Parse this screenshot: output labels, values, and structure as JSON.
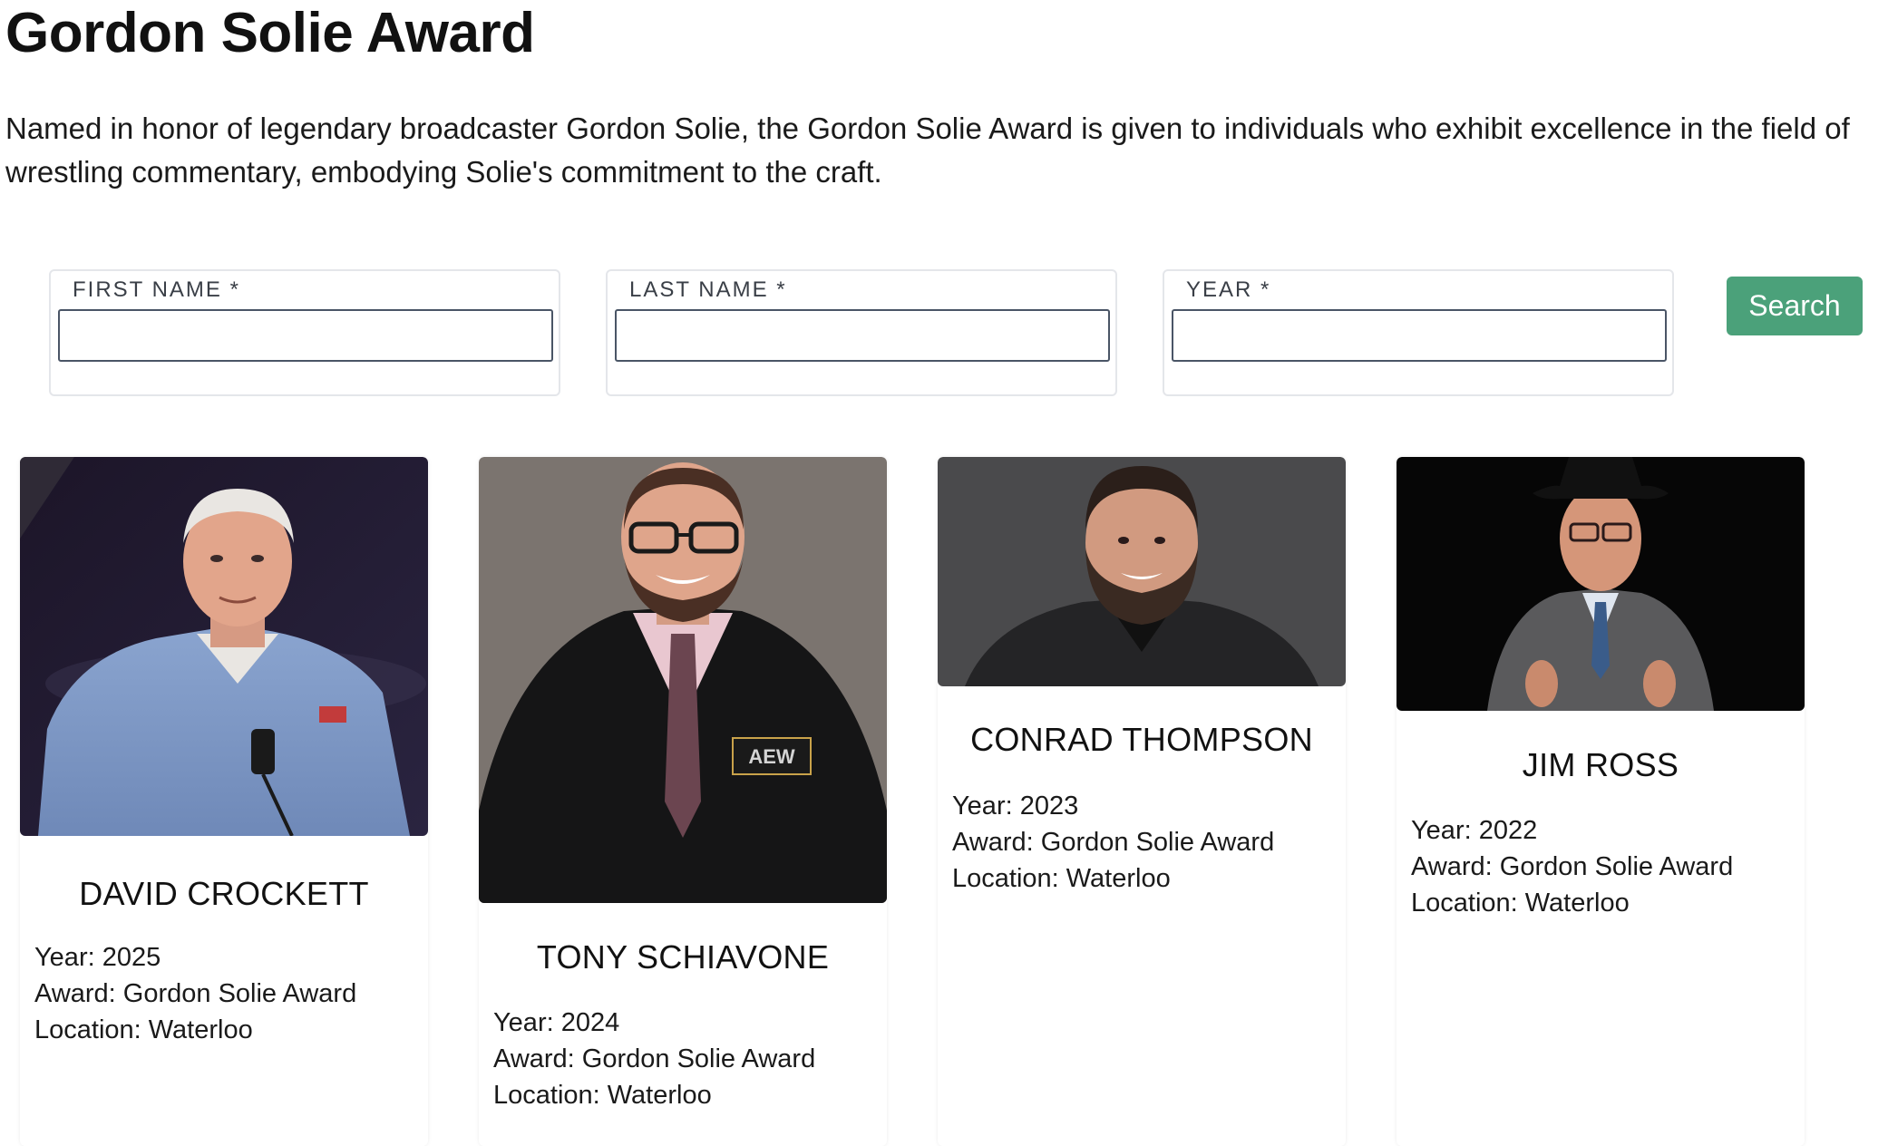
{
  "page": {
    "title": "Gordon Solie Award",
    "description": "Named in honor of legendary broadcaster Gordon Solie, the Gordon Solie Award is given to individuals who exhibit excellence in the field of wrestling commentary, embodying Solie's commitment to the craft."
  },
  "search": {
    "first_name_label": "FIRST NAME *",
    "last_name_label": "LAST NAME *",
    "year_label": "YEAR *",
    "first_name_value": "",
    "last_name_value": "",
    "year_value": "",
    "button_label": "Search"
  },
  "cards": [
    {
      "name": "DAVID CROCKETT",
      "year": "Year: 2025",
      "award": "Award: Gordon Solie Award",
      "location": "Location: Waterloo"
    },
    {
      "name": "TONY SCHIAVONE",
      "year": "Year: 2024",
      "award": "Award: Gordon Solie Award",
      "location": "Location: Waterloo"
    },
    {
      "name": "CONRAD THOMPSON",
      "year": "Year: 2023",
      "award": "Award: Gordon Solie Award",
      "location": "Location: Waterloo"
    },
    {
      "name": "JIM ROSS",
      "year": "Year: 2022",
      "award": "Award: Gordon Solie Award",
      "location": "Location: Waterloo"
    }
  ],
  "colors": {
    "accent": "#4ba17a",
    "input_border": "#4a5566",
    "field_border": "#e4e6ea"
  }
}
